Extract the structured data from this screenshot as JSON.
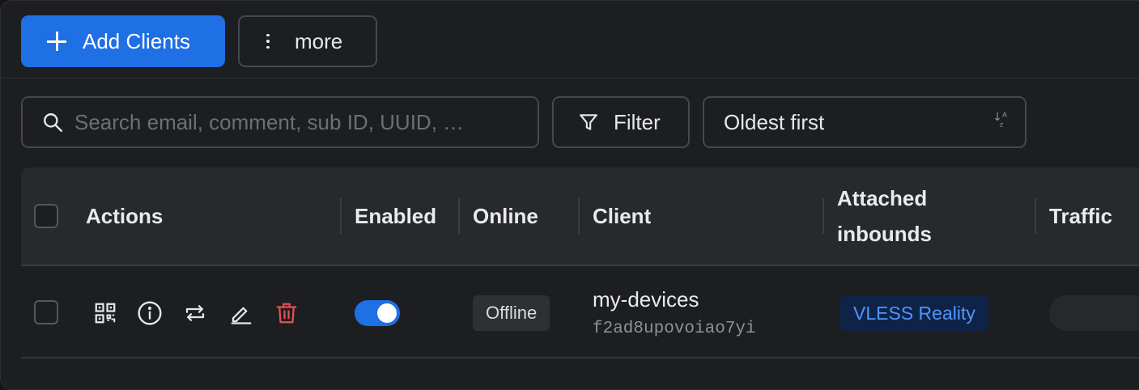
{
  "toolbar": {
    "add_clients_label": "Add Clients",
    "more_label": "more"
  },
  "search": {
    "placeholder": "Search email, comment, sub ID, UUID, …"
  },
  "filter_label": "Filter",
  "sort_label": "Oldest first",
  "table": {
    "columns": [
      "Actions",
      "Enabled",
      "Online",
      "Client",
      "Attached inbounds",
      "Traffic"
    ],
    "rows": [
      {
        "enabled": true,
        "online_status": "Offline",
        "client_name": "my-devices",
        "client_id": "f2ad8upovoiao7yi",
        "inbound": "VLESS Reality"
      }
    ]
  },
  "colors": {
    "accent": "#1f6fe5",
    "danger": "#e05252",
    "inbound_badge_text": "#4f95ff"
  },
  "icons": [
    "plus-icon",
    "more-vertical-icon",
    "search-icon",
    "filter-icon",
    "sort-icon",
    "qr-code-icon",
    "info-icon",
    "reset-icon",
    "edit-icon",
    "delete-icon"
  ]
}
